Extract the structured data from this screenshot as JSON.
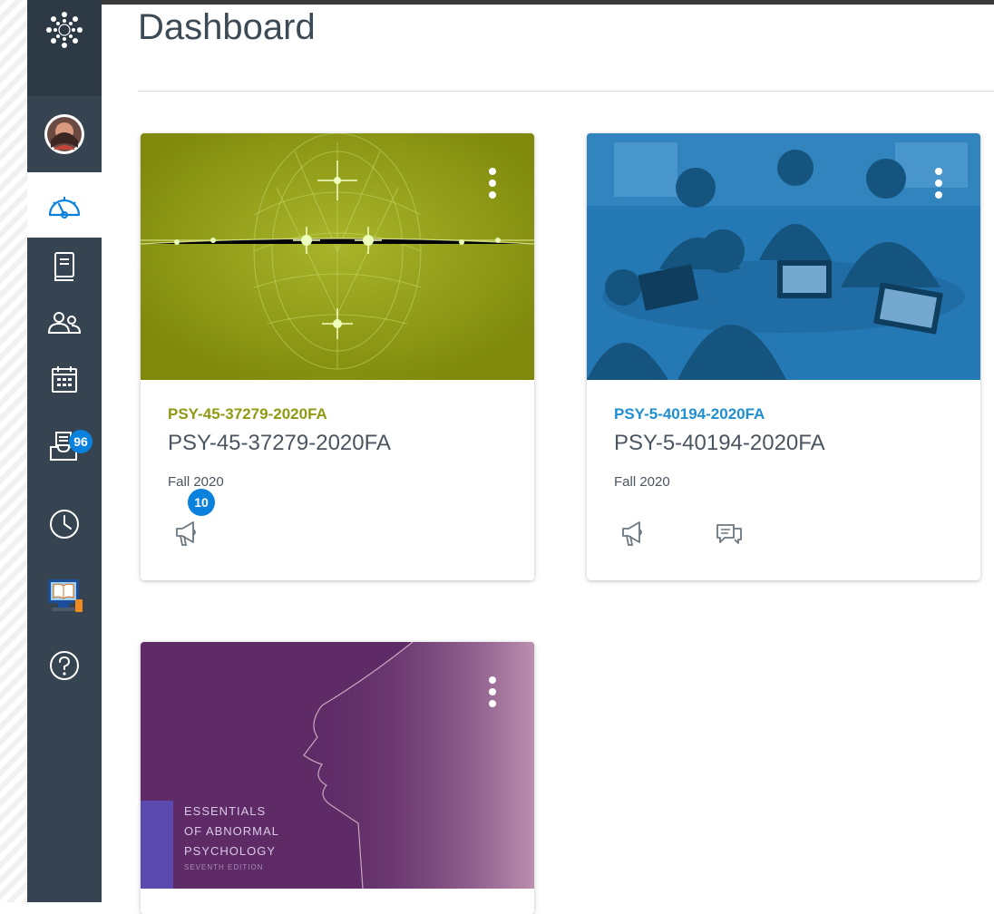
{
  "page": {
    "title": "Dashboard"
  },
  "sidebar": {
    "logo_icon": "canvas-logo-icon",
    "items": [
      {
        "id": "account",
        "icon": "avatar"
      },
      {
        "id": "dashboard",
        "icon": "dashboard-icon",
        "active": true
      },
      {
        "id": "courses",
        "icon": "courses-icon"
      },
      {
        "id": "groups",
        "icon": "groups-icon"
      },
      {
        "id": "calendar",
        "icon": "calendar-icon"
      },
      {
        "id": "inbox",
        "icon": "inbox-icon",
        "badge": "96"
      },
      {
        "id": "history",
        "icon": "clock-icon"
      },
      {
        "id": "commons",
        "icon": "laptop-book-icon"
      },
      {
        "id": "help",
        "icon": "help-icon"
      }
    ]
  },
  "cards": [
    {
      "code": "PSY-45-37279-2020FA",
      "name": "PSY-45-37279-2020FA",
      "term": "Fall 2020",
      "color": "#8f9a11",
      "announcements_badge": "10"
    },
    {
      "code": "PSY-5-40194-2020FA",
      "name": "PSY-5-40194-2020FA",
      "term": "Fall 2020",
      "color": "#1e8fd2"
    },
    {
      "cover_text": [
        "ESSENTIALS",
        "OF ABNORMAL",
        "PSYCHOLOGY"
      ],
      "cover_subtext": "SEVENTH EDITION",
      "color": "#5e2b66"
    }
  ],
  "colors": {
    "sidebar": "#364350",
    "badge": "#0a82dd",
    "text": "#3c4a56"
  }
}
